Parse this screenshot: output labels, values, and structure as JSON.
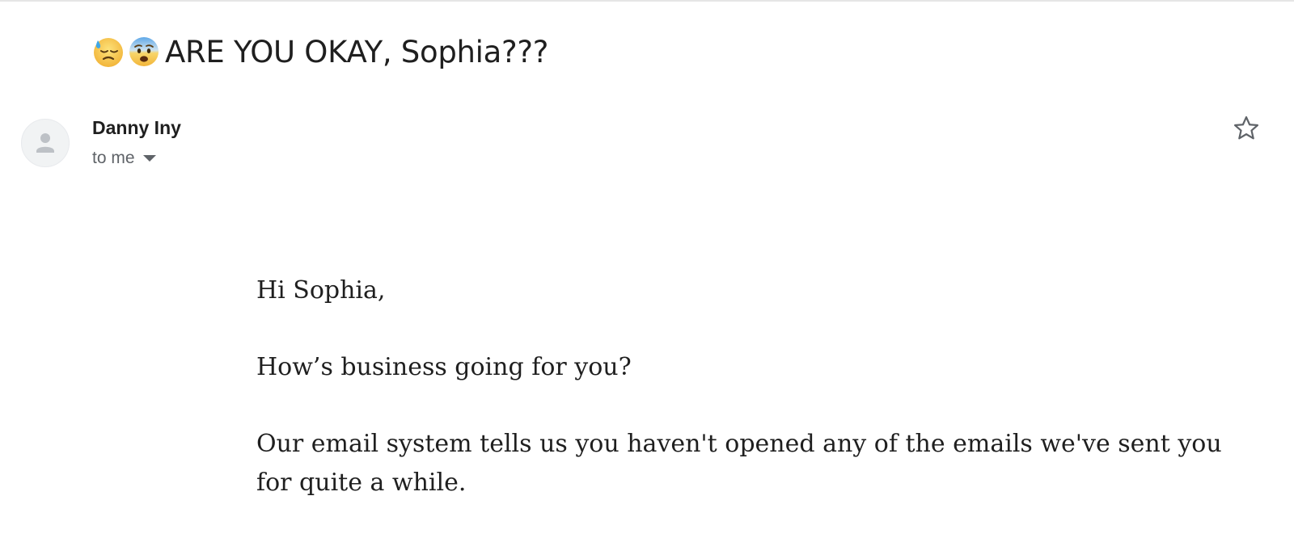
{
  "subject": {
    "emojis": [
      "downcast-face-with-sweat",
      "fearful-face"
    ],
    "text": "ARE YOU OKAY, Sophia???"
  },
  "sender": {
    "name": "Danny Iny",
    "recipient_label": "to me",
    "avatar_icon": "person-icon"
  },
  "actions": {
    "star_icon": "star-outline-icon"
  },
  "message": {
    "greeting": "Hi Sophia,",
    "paragraphs": [
      "How’s business going for you?",
      "Our email system tells us you haven't opened any of the emails we've sent you for quite a while."
    ]
  },
  "colors": {
    "text_primary": "#1f1f1f",
    "text_secondary": "#5f6368",
    "avatar_bg": "#f1f3f4",
    "emoji_yellow": "#f7c14a",
    "emoji_blue": "#5fa8e8"
  }
}
